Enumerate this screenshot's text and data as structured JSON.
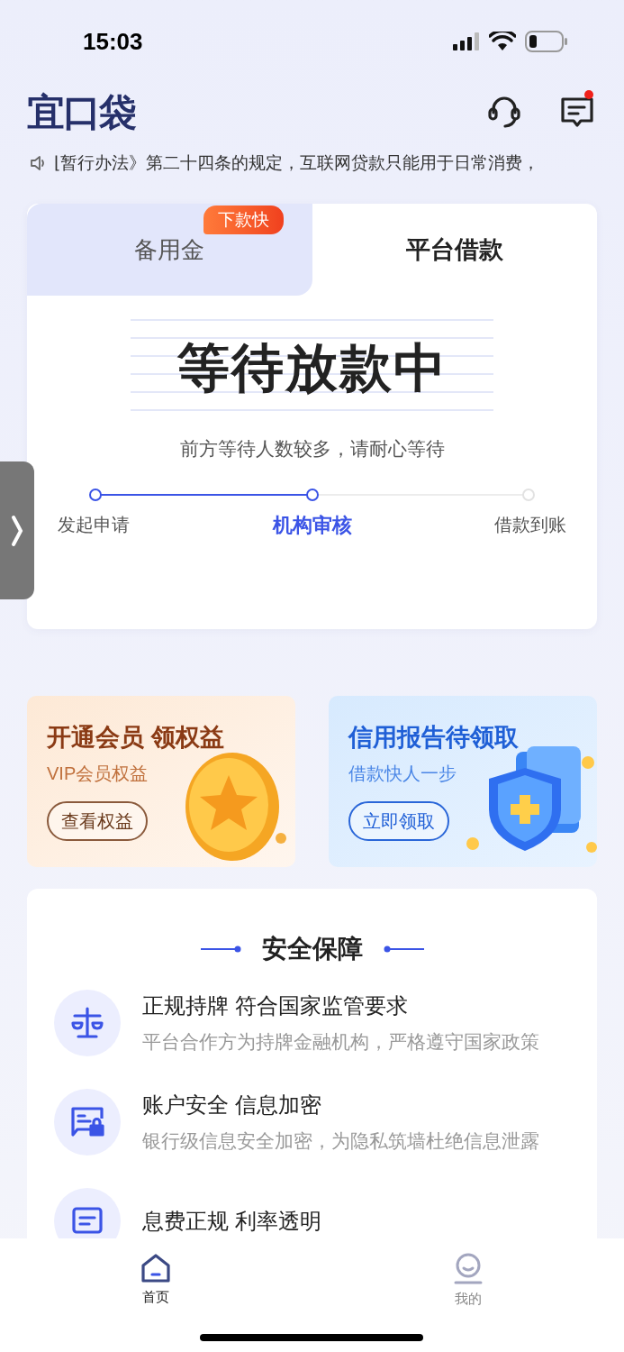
{
  "status_bar": {
    "time": "15:03"
  },
  "header": {
    "logo": "宜口袋",
    "messages_unread": true
  },
  "notice": {
    "text": "⌊暂行办法》第二十四条的规定，互联网贷款只能用于日常消费，"
  },
  "loan_card": {
    "tabs": [
      {
        "label": "备用金",
        "selected": false,
        "badge": "下款快"
      },
      {
        "label": "平台借款",
        "selected": true
      }
    ],
    "title": "等待放款中",
    "subtitle": "前方等待人数较多，请耐心等待",
    "steps": [
      {
        "label": "发起申请",
        "completed": true,
        "selected": false
      },
      {
        "label": "机构审核",
        "completed": true,
        "selected": true
      },
      {
        "label": "借款到账",
        "completed": false,
        "selected": false
      }
    ]
  },
  "promos": [
    {
      "kind": "vip",
      "title": "开通会员 领权益",
      "subtitle": "VIP会员权益",
      "button": "查看权益"
    },
    {
      "kind": "credit",
      "title": "信用报告待领取",
      "subtitle": "借款快人一步",
      "button": "立即领取"
    }
  ],
  "security": {
    "title": "安全保障",
    "items": [
      {
        "kind": "scale",
        "title": "正规持牌 符合国家监管要求",
        "description": "平台合作方为持牌金融机构，严格遵守国家政策"
      },
      {
        "kind": "lock",
        "title": "账户安全 信息加密",
        "description": "银行级信息安全加密，为隐私筑墙杜绝信息泄露"
      },
      {
        "kind": "document",
        "title": "息费正规  利率透明"
      }
    ]
  },
  "bottom_nav": [
    {
      "kind": "home",
      "label": "首页",
      "selected": true
    },
    {
      "kind": "profile",
      "label": "我的",
      "selected": false
    }
  ]
}
